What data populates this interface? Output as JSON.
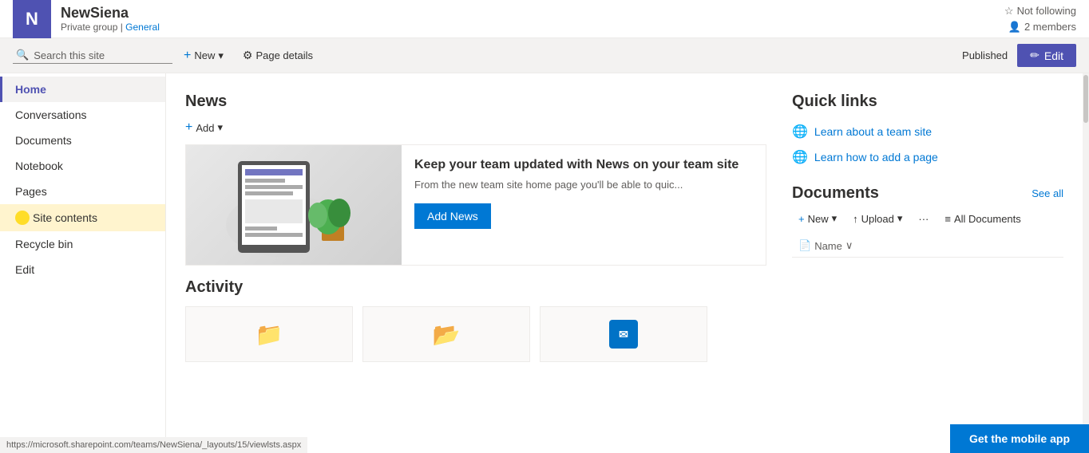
{
  "header": {
    "site_initial": "N",
    "site_name": "NewSiena",
    "site_meta": "Private group | General",
    "site_meta_group": "Private group",
    "site_meta_separator": " | ",
    "site_meta_channel": "General",
    "not_following": "Not following",
    "members": "2 members"
  },
  "toolbar": {
    "new_label": "New",
    "page_details_label": "Page details",
    "published_label": "Published",
    "edit_label": "Edit",
    "search_placeholder": "Search this site"
  },
  "sidebar": {
    "items": [
      {
        "id": "home",
        "label": "Home",
        "active": true
      },
      {
        "id": "conversations",
        "label": "Conversations",
        "active": false
      },
      {
        "id": "documents",
        "label": "Documents",
        "active": false
      },
      {
        "id": "notebook",
        "label": "Notebook",
        "active": false
      },
      {
        "id": "pages",
        "label": "Pages",
        "active": false
      },
      {
        "id": "site-contents",
        "label": "Site contents",
        "active": false,
        "highlighted": true
      },
      {
        "id": "recycle-bin",
        "label": "Recycle bin",
        "active": false
      },
      {
        "id": "edit",
        "label": "Edit",
        "active": false
      }
    ]
  },
  "news": {
    "title": "News",
    "add_label": "Add",
    "headline": "Keep your team updated with News on your team site",
    "description": "From the new team site home page you'll be able to quic...",
    "add_news_btn": "Add News"
  },
  "activity": {
    "title": "Activity"
  },
  "quick_links": {
    "title": "Quick links",
    "items": [
      {
        "label": "Learn about a team site"
      },
      {
        "label": "Learn how to add a page"
      }
    ]
  },
  "documents": {
    "title": "Documents",
    "see_all": "See all",
    "new_label": "New",
    "upload_label": "Upload",
    "more_label": "···",
    "all_docs_label": "All Documents",
    "name_col": "Name"
  },
  "status_bar": {
    "url": "https://microsoft.sharepoint.com/teams/NewSiena/_layouts/15/viewlsts.aspx"
  },
  "mobile_app": {
    "label": "Get the mobile app"
  }
}
